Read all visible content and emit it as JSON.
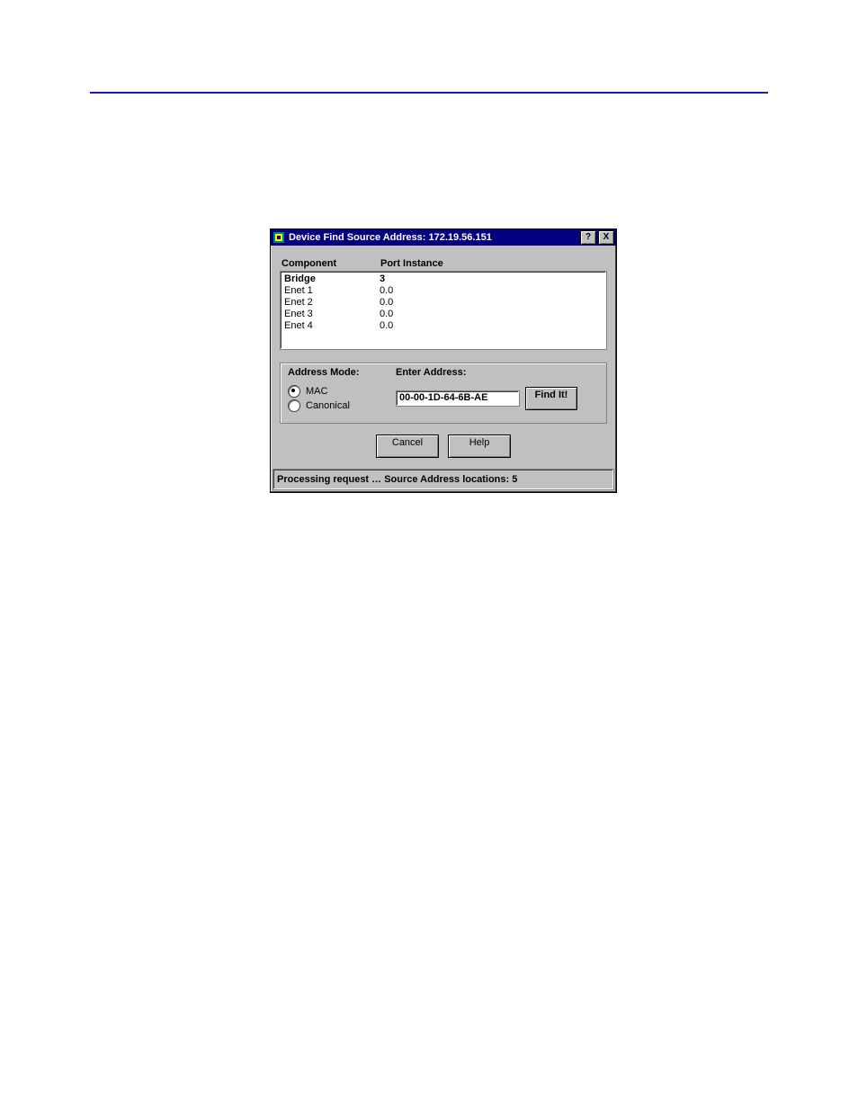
{
  "window": {
    "title": "Device Find Source Address:  172.19.56.151"
  },
  "list": {
    "headers": {
      "component": "Component",
      "port_instance": "Port Instance"
    },
    "rows": [
      {
        "component": "Bridge",
        "port": "3"
      },
      {
        "component": "Enet 1",
        "port": "0.0"
      },
      {
        "component": "Enet 2",
        "port": "0.0"
      },
      {
        "component": "Enet 3",
        "port": "0.0"
      },
      {
        "component": "Enet 4",
        "port": "0.0"
      }
    ]
  },
  "panel": {
    "mode_label": "Address Mode:",
    "enter_label": "Enter Address:",
    "radio_mac": "MAC",
    "radio_canonical": "Canonical",
    "address_value": "00-00-1D-64-6B-AE",
    "find_label": "Find It!"
  },
  "buttons": {
    "cancel": "Cancel",
    "help": "Help"
  },
  "status": "Processing request … Source Address locations: 5",
  "titlebar_buttons": {
    "help": "?",
    "close": "X"
  }
}
